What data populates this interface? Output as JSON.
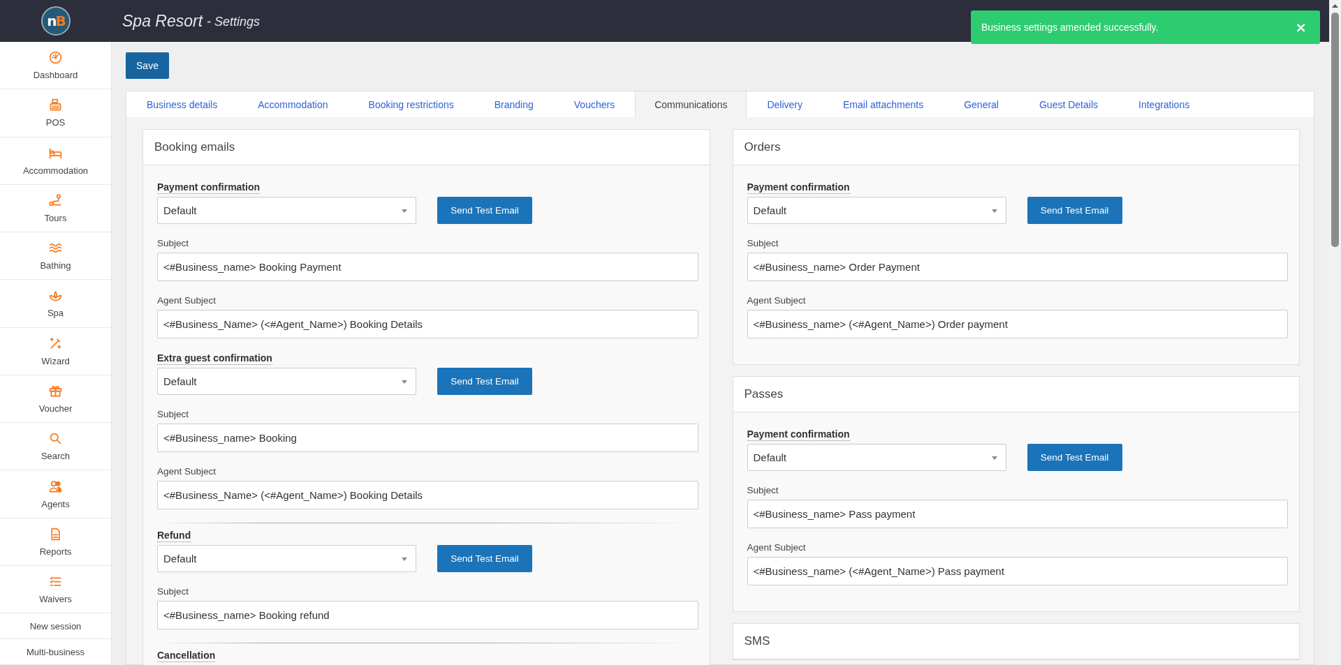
{
  "header": {
    "logo": "nB",
    "title": "Spa Resort",
    "page": "- Settings"
  },
  "sidebar": {
    "items": [
      {
        "label": "Dashboard",
        "kind": "dashboard"
      },
      {
        "label": "POS",
        "kind": "pos"
      },
      {
        "label": "Accommodation",
        "kind": "accommodation"
      },
      {
        "label": "Tours",
        "kind": "tours"
      },
      {
        "label": "Bathing",
        "kind": "bathing"
      },
      {
        "label": "Spa",
        "kind": "spa"
      },
      {
        "label": "Wizard",
        "kind": "wizard"
      },
      {
        "label": "Voucher",
        "kind": "voucher"
      },
      {
        "label": "Search",
        "kind": "search"
      },
      {
        "label": "Agents",
        "kind": "agents"
      },
      {
        "label": "Reports",
        "kind": "reports"
      },
      {
        "label": "Waivers",
        "kind": "waivers"
      }
    ],
    "links": [
      "New session",
      "Multi-business"
    ]
  },
  "toast": {
    "message": "Business settings amended successfully.",
    "close": "×"
  },
  "save_button": "Save",
  "tabs": [
    {
      "label": "Business details",
      "selected": false
    },
    {
      "label": "Accommodation",
      "selected": false
    },
    {
      "label": "Booking restrictions",
      "selected": false
    },
    {
      "label": "Branding",
      "selected": false
    },
    {
      "label": "Vouchers",
      "selected": false
    },
    {
      "label": "Communications",
      "selected": true
    },
    {
      "label": "Delivery",
      "selected": false
    },
    {
      "label": "Email attachments",
      "selected": false
    },
    {
      "label": "General",
      "selected": false
    },
    {
      "label": "Guest Details",
      "selected": false
    },
    {
      "label": "Integrations",
      "selected": false
    }
  ],
  "columns": [
    [
      {
        "title": "Booking emails",
        "sections": [
          {
            "label": "Payment confirmation",
            "divider": false,
            "template": "Default",
            "button": "Send Test Email",
            "fields": [
              {
                "label": "Subject",
                "value": "<#Business_name> Booking Payment"
              },
              {
                "label": "Agent Subject",
                "value": "<#Business_Name> (<#Agent_Name>) Booking Details"
              }
            ]
          },
          {
            "label": "Extra guest confirmation",
            "divider": false,
            "template": "Default",
            "button": "Send Test Email",
            "fields": [
              {
                "label": "Subject",
                "value": "<#Business_name> Booking"
              },
              {
                "label": "Agent Subject",
                "value": "<#Business_Name> (<#Agent_Name>) Booking Details"
              }
            ]
          },
          {
            "label": "Refund",
            "divider": true,
            "template": "Default",
            "button": "Send Test Email",
            "fields": [
              {
                "label": "Subject",
                "value": "<#Business_name> Booking refund"
              }
            ]
          },
          {
            "label": "Cancellation",
            "divider": true
          }
        ]
      }
    ],
    [
      {
        "title": "Orders",
        "sections": [
          {
            "label": "Payment confirmation",
            "divider": false,
            "template": "Default",
            "button": "Send Test Email",
            "fields": [
              {
                "label": "Subject",
                "value": "<#Business_name> Order Payment"
              },
              {
                "label": "Agent Subject",
                "value": "<#Business_name> (<#Agent_Name>) Order payment"
              }
            ]
          }
        ]
      },
      {
        "title": "Passes",
        "sections": [
          {
            "label": "Payment confirmation",
            "divider": false,
            "template": "Default",
            "button": "Send Test Email",
            "fields": [
              {
                "label": "Subject",
                "value": "<#Business_name> Pass payment"
              },
              {
                "label": "Agent Subject",
                "value": "<#Business_name> (<#Agent_Name>) Pass payment"
              }
            ]
          }
        ]
      },
      {
        "title": "SMS"
      }
    ]
  ]
}
